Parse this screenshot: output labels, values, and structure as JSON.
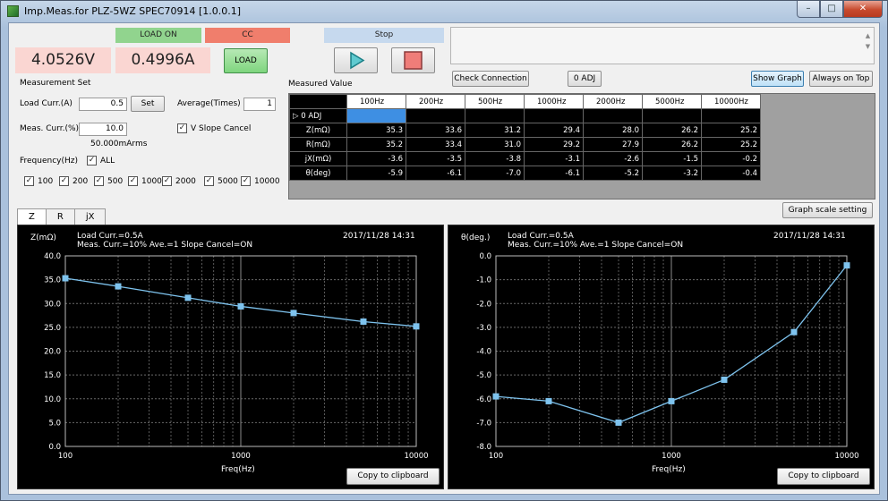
{
  "window": {
    "title": "Imp.Meas.for PLZ-5WZ SPEC70914 [1.0.0.1]",
    "controls": {
      "minimize": "–",
      "maximize": "□",
      "close": "✕"
    }
  },
  "status": {
    "voltage": "4.0526V",
    "current": "0.4996A",
    "load_on": "LOAD ON",
    "mode": "CC",
    "load_button": "LOAD",
    "stop": "Stop",
    "load_on_color": "#91d48e",
    "mode_color": "#f07e6c",
    "stop_color": "#c6d9ee"
  },
  "toolbar": {
    "check_connection": "Check Connection",
    "zero_adj": "0 ADJ",
    "show_graph": "Show Graph",
    "always_on_top": "Always on Top",
    "graph_scale": "Graph scale setting",
    "play_icon": "play-icon",
    "stop_icon": "stop-icon"
  },
  "measurement_set": {
    "title": "Measurement Set",
    "load_curr_label": "Load Curr.(A)",
    "load_curr_value": "0.5",
    "set_button": "Set",
    "average_label": "Average(Times)",
    "average_value": "1",
    "meas_curr_label": "Meas. Curr.(%)",
    "meas_curr_value": "10.0",
    "meas_curr_rms": "50.000mArms",
    "v_slope_cancel": "V Slope Cancel",
    "frequency_label": "Frequency(Hz)",
    "all_label": "ALL",
    "frequencies": [
      "100",
      "200",
      "500",
      "1000",
      "2000",
      "5000",
      "10000"
    ]
  },
  "measured": {
    "title": "Measured Value",
    "columns": [
      "100Hz",
      "200Hz",
      "500Hz",
      "1000Hz",
      "2000Hz",
      "5000Hz",
      "10000Hz"
    ],
    "rows": [
      {
        "label": "0 ADJ",
        "values": [
          "",
          "",
          "",
          "",
          "",
          "",
          ""
        ]
      },
      {
        "label": "Z(mΩ)",
        "values": [
          "35.3",
          "33.6",
          "31.2",
          "29.4",
          "28.0",
          "26.2",
          "25.2"
        ]
      },
      {
        "label": "R(mΩ)",
        "values": [
          "35.2",
          "33.4",
          "31.0",
          "29.2",
          "27.9",
          "26.2",
          "25.2"
        ]
      },
      {
        "label": "jX(mΩ)",
        "values": [
          "-3.6",
          "-3.5",
          "-3.8",
          "-3.1",
          "-2.6",
          "-1.5",
          "-0.2"
        ]
      },
      {
        "label": "θ(deg)",
        "values": [
          "-5.9",
          "-6.1",
          "-7.0",
          "-6.1",
          "-5.2",
          "-3.2",
          "-0.4"
        ]
      }
    ],
    "selection_color": "#3e8fe3"
  },
  "tabs": [
    "Z",
    "R",
    "jX"
  ],
  "chart_info": {
    "info_line1": "Load Curr.=0.5A",
    "info_line2": "Meas. Curr.=10%  Ave.=1  Slope Cancel=ON",
    "timestamp": "2017/11/28 14:31",
    "copy_button": "Copy to clipboard"
  },
  "chart_data": [
    {
      "type": "line",
      "ylabel": "Z(mΩ)",
      "xlabel": "Freq(Hz)",
      "x_scale": "log",
      "x": [
        100,
        200,
        500,
        1000,
        2000,
        5000,
        10000
      ],
      "y": [
        35.3,
        33.6,
        31.2,
        29.4,
        28.0,
        26.2,
        25.2
      ],
      "xlim": [
        100,
        10000
      ],
      "ylim": [
        0,
        40
      ],
      "yticks": [
        0,
        5,
        10,
        15,
        20,
        25,
        30,
        35,
        40
      ],
      "ytick_labels": [
        "0.0",
        "5.0",
        "10.0",
        "15.0",
        "20.0",
        "25.0",
        "30.0",
        "35.0",
        "40.0"
      ],
      "xtick_labels": [
        "100",
        "1000",
        "10000"
      ],
      "grid": true,
      "series_color": "#7ec3ee"
    },
    {
      "type": "line",
      "ylabel": "θ(deg.)",
      "xlabel": "Freq(Hz)",
      "x_scale": "log",
      "x": [
        100,
        200,
        500,
        1000,
        2000,
        5000,
        10000
      ],
      "y": [
        -5.9,
        -6.1,
        -7.0,
        -6.1,
        -5.2,
        -3.2,
        -0.4
      ],
      "xlim": [
        100,
        10000
      ],
      "ylim": [
        -8,
        0
      ],
      "yticks": [
        -8,
        -7,
        -6,
        -5,
        -4,
        -3,
        -2,
        -1,
        0
      ],
      "ytick_labels": [
        "-8.0",
        "-7.0",
        "-6.0",
        "-5.0",
        "-4.0",
        "-3.0",
        "-2.0",
        "-1.0",
        "0.0"
      ],
      "xtick_labels": [
        "100",
        "1000",
        "10000"
      ],
      "grid": true,
      "series_color": "#7ec3ee"
    }
  ]
}
